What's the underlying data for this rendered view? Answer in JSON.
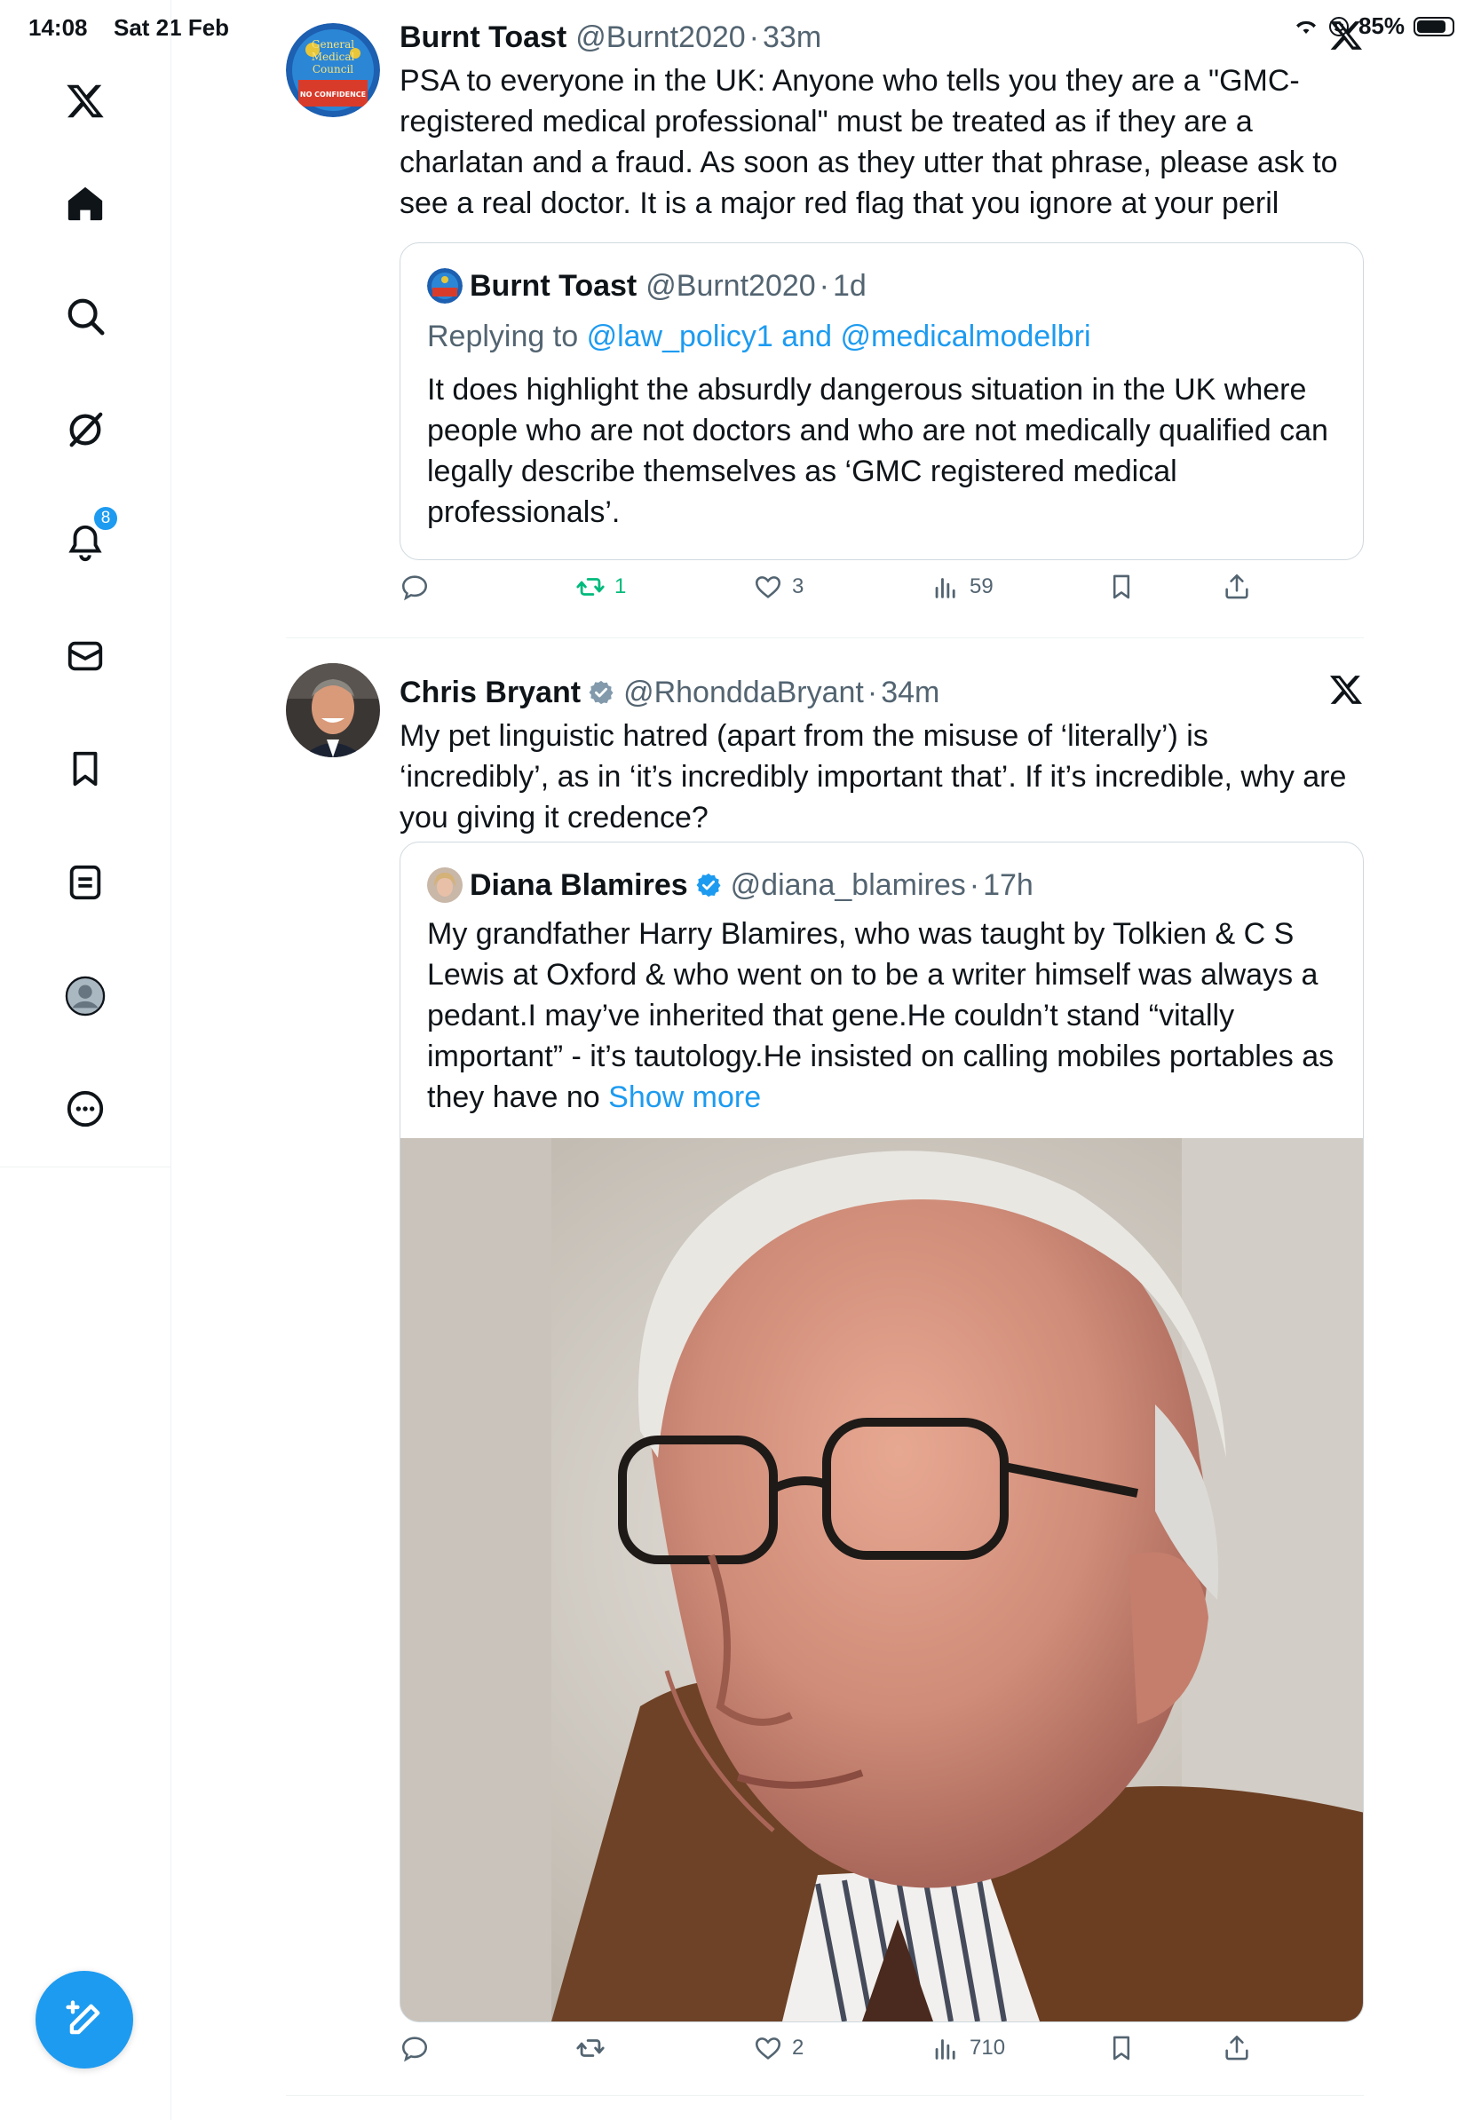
{
  "status_bar": {
    "time": "14:08",
    "date": "Sat 21 Feb",
    "battery": "85%",
    "battery_level": 0.85
  },
  "sidebar": {
    "items": [
      {
        "icon": "x-logo-icon"
      },
      {
        "icon": "home-icon"
      },
      {
        "icon": "search-icon"
      },
      {
        "icon": "grok-icon"
      },
      {
        "icon": "bell-icon",
        "badge": "8"
      },
      {
        "icon": "mail-icon"
      },
      {
        "icon": "bookmark-icon"
      },
      {
        "icon": "list-icon"
      },
      {
        "icon": "profile-icon"
      },
      {
        "icon": "more-icon"
      }
    ],
    "compose_icon": "compose-icon"
  },
  "colors": {
    "accent": "#1d9bf0",
    "retweet_active": "#00ba7c",
    "text": "#0f1419",
    "muted": "#536471"
  },
  "tweets": [
    {
      "name": "Burnt Toast",
      "handle": "@Burnt2020",
      "time": "33m",
      "text": "PSA to everyone in the UK: Anyone who tells you they are a \"GMC-registered medical professional\" must be treated as if they are a charlatan and a fraud. As soon as they utter that phrase, please ask to see a real doctor. It is a major red flag that you ignore at your peril",
      "quote": {
        "name": "Burnt Toast",
        "handle": "@Burnt2020",
        "time": "1d",
        "replying_prefix": "Replying to",
        "replying_user1": "@law_policy1",
        "replying_and": "and",
        "replying_user2": "@medicalmodelbri",
        "text": "It does highlight the absurdly dangerous situation in the UK where people who are not doctors and who are not medically qualified can legally describe themselves as ‘GMC registered medical professionals’."
      },
      "actions": {
        "replies": "",
        "retweets": "1",
        "likes": "3",
        "views": "59"
      },
      "avatar_text": {
        "line1": "General",
        "line2": "Medical",
        "line3": "Council",
        "badge": "NO CONFIDENCE"
      }
    },
    {
      "name": "Chris Bryant",
      "handle": "@RhonddaBryant",
      "time": "34m",
      "text": "My pet linguistic hatred (apart from the misuse of ‘literally’) is ‘incredibly’, as in ‘it’s incredibly important that’. If it’s incredible, why are you giving it credence?",
      "quote": {
        "name": "Diana Blamires",
        "handle": "@diana_blamires",
        "time": "17h",
        "text": "My grandfather Harry Blamires, who was taught by Tolkien & C S Lewis at Oxford & who went on to be a writer himself was always a pedant.I may’ve inherited that gene.He couldn’t stand “vitally important” - it’s tautology.He insisted on calling mobiles portables as they have no",
        "show_more": "Show more"
      },
      "actions": {
        "replies": "",
        "retweets": "",
        "likes": "2",
        "views": "710"
      }
    }
  ]
}
